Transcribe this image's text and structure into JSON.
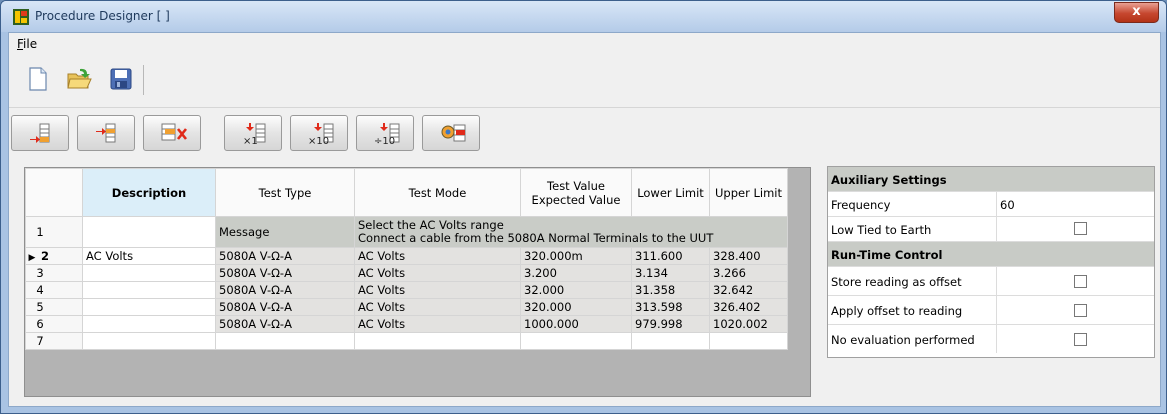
{
  "window": {
    "title": "Procedure Designer [ ]",
    "close_label": "x"
  },
  "menu": {
    "file": "File",
    "file_accel": "F",
    "file_rest": "ile"
  },
  "toolbar": {
    "file_icons": [
      "new-file-icon",
      "open-folder-icon",
      "save-icon"
    ],
    "step_buttons": [
      "insert-step-before-icon",
      "insert-step-after-icon",
      "delete-step-icon",
      "step-multiply-1-icon",
      "step-multiply-10-icon",
      "step-divide-10-icon",
      "step-settings-icon"
    ]
  },
  "grid": {
    "headers": {
      "description": "Description",
      "test_type": "Test Type",
      "test_mode": "Test Mode",
      "test_value_1": "Test Value",
      "test_value_2": "Expected Value",
      "lower": "Lower Limit",
      "upper": "Upper Limit"
    },
    "message_row": {
      "num": "1",
      "type": "Message",
      "line1": "Select the AC Volts range",
      "line2": "Connect a cable from the 5080A Normal Terminals to the UUT"
    },
    "rows": [
      {
        "num": "2",
        "desc": "AC Volts",
        "type": "5080A V-Ω-A",
        "mode": "AC Volts",
        "value": "320.000m",
        "lower": "311.600",
        "upper": "328.400"
      },
      {
        "num": "3",
        "desc": "",
        "type": "5080A V-Ω-A",
        "mode": "AC Volts",
        "value": "3.200",
        "lower": "3.134",
        "upper": "3.266"
      },
      {
        "num": "4",
        "desc": "",
        "type": "5080A V-Ω-A",
        "mode": "AC Volts",
        "value": "32.000",
        "lower": "31.358",
        "upper": "32.642"
      },
      {
        "num": "5",
        "desc": "",
        "type": "5080A V-Ω-A",
        "mode": "AC Volts",
        "value": "320.000",
        "lower": "313.598",
        "upper": "326.402"
      },
      {
        "num": "6",
        "desc": "",
        "type": "5080A V-Ω-A",
        "mode": "AC Volts",
        "value": "1000.000",
        "lower": "979.998",
        "upper": "1020.002"
      }
    ],
    "empty_row_num": "7",
    "current_row_marker": "▶"
  },
  "aux": {
    "aux_title": "Auxiliary Settings",
    "frequency_label": "Frequency",
    "frequency_value": "60",
    "low_tied_label": "Low Tied to Earth",
    "runtime_title": "Run-Time Control",
    "store_label": "Store reading as offset",
    "apply_label": "Apply offset to reading",
    "noeval_label": "No evaluation performed",
    "low_tied_checked": false,
    "store_checked": false,
    "apply_checked": false,
    "noeval_checked": false
  },
  "colors": {
    "accent": "#dbeef9",
    "message_row": "#c9ccc7",
    "grid_gray": "#e3e2e0"
  }
}
